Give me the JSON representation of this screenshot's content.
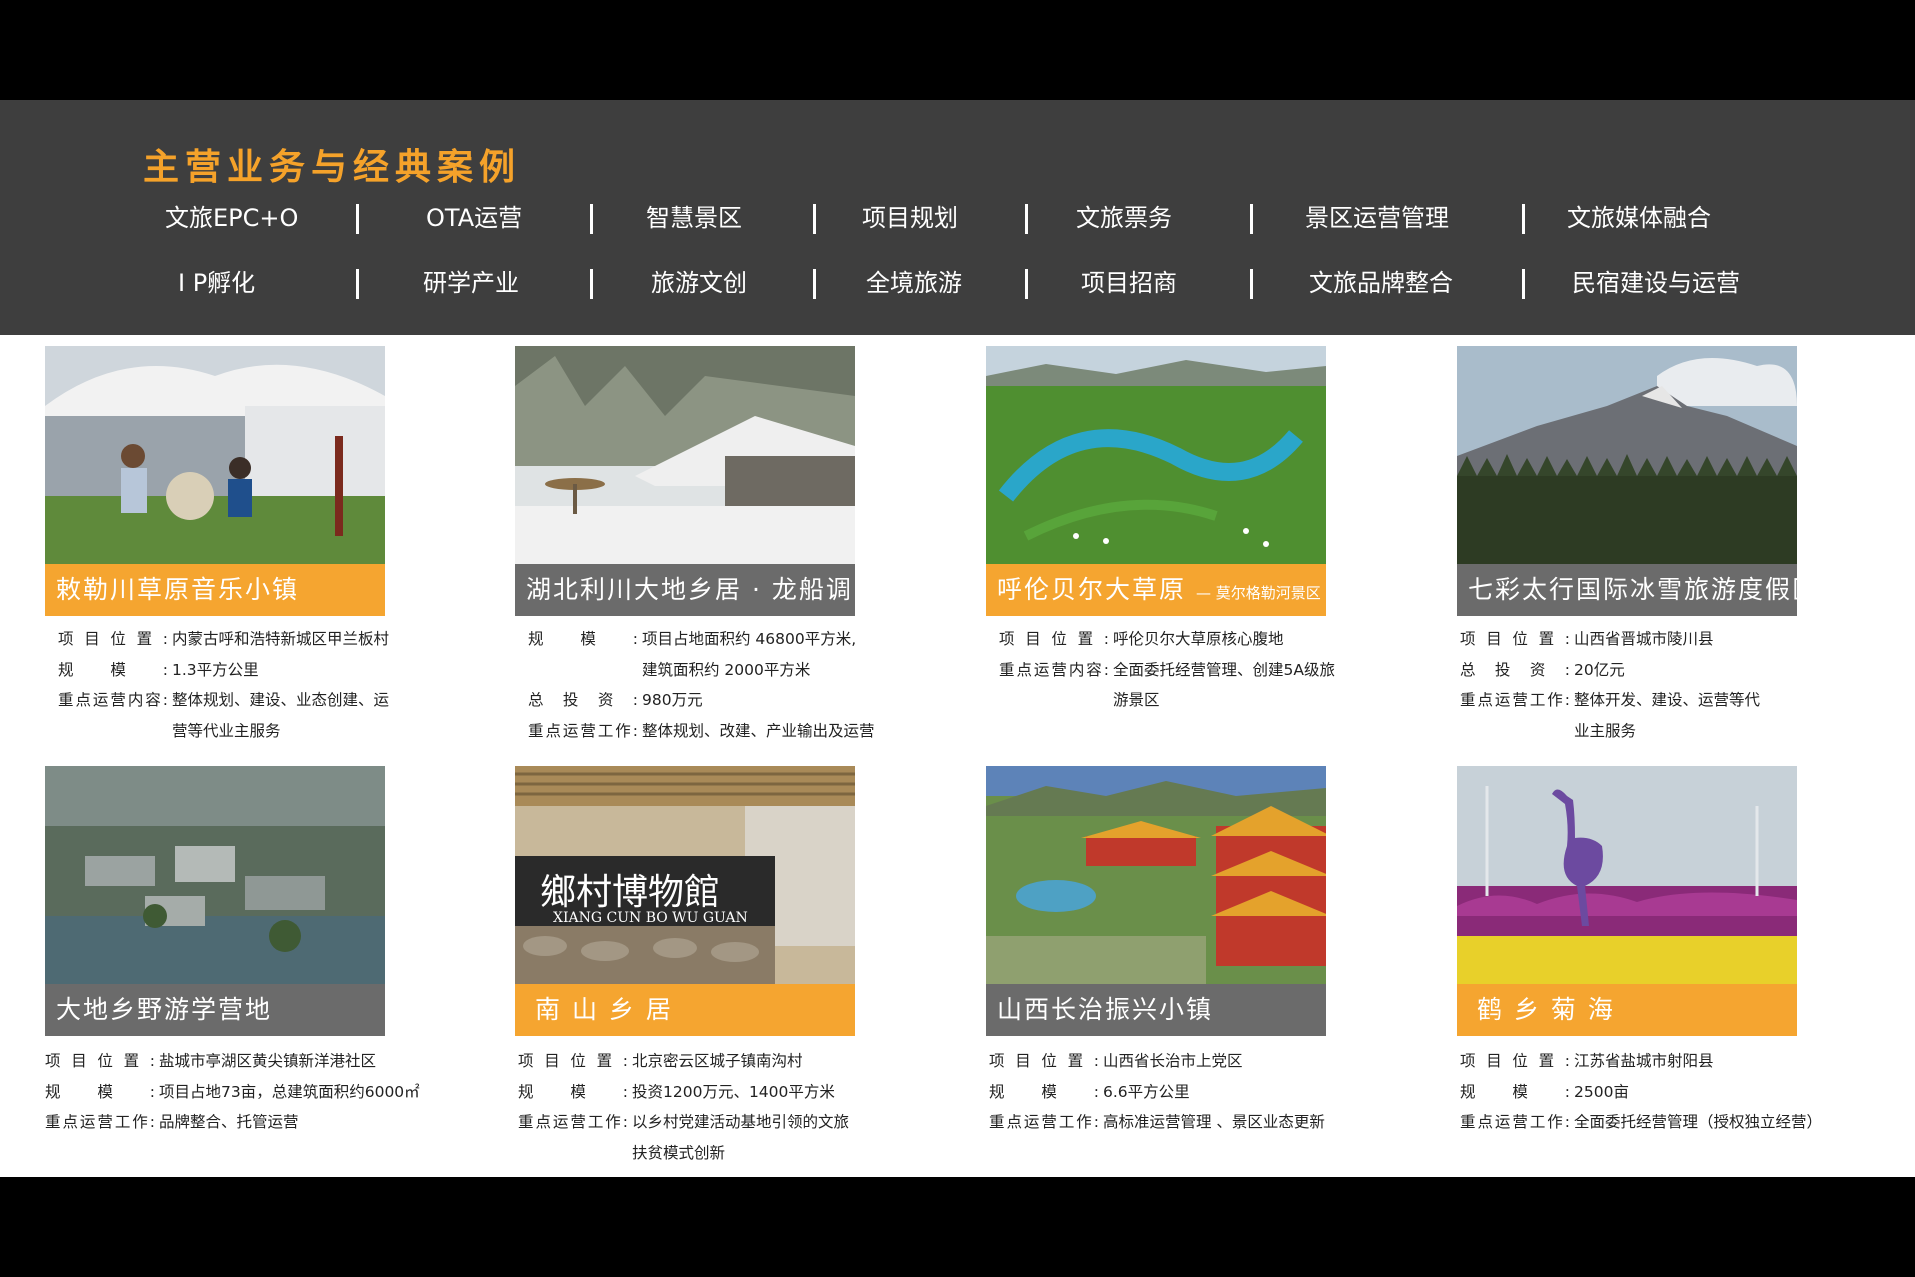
{
  "header": {
    "title": "主营业务与经典案例",
    "services_row1": [
      "文旅EPC+O",
      "OTA运营",
      "智慧景区",
      "项目规划",
      "文旅票务",
      "景区运营管理",
      "文旅媒体融合"
    ],
    "services_row2": [
      "I P孵化",
      "研学产业",
      "旅游文创",
      "全境旅游",
      "项目招商",
      "文旅品牌整合",
      "民宿建设与运营"
    ]
  },
  "colors": {
    "accent": "#f5a22a",
    "header_bg": "#3e3e3e",
    "banner_orange": "#f5a530",
    "banner_gray": "#6b6b6b"
  },
  "cases": [
    {
      "name": "敕勒川草原音乐小镇",
      "sub": "",
      "rows": [
        {
          "label": "项目位置:",
          "value": "内蒙古呼和浩特新城区甲兰板村"
        },
        {
          "label": "规模:",
          "value": "1.3平方公里"
        },
        {
          "label": "重点运营内容:",
          "value": "整体规划、建设、业态创建、运"
        },
        {
          "label": "",
          "value": "营等代业主服务"
        }
      ]
    },
    {
      "name": "湖北利川大地乡居 · 龙船调",
      "sub": "",
      "rows": [
        {
          "label": "规模:",
          "value": "项目占地面积约 46800平方米,"
        },
        {
          "label": "",
          "value": "建筑面积约 2000平方米"
        },
        {
          "label": "总投资:",
          "value": "980万元"
        },
        {
          "label": "重点运营工作:",
          "value": "整体规划、改建、产业输出及运营"
        }
      ]
    },
    {
      "name": "呼伦贝尔大草原",
      "sub": "— 莫尔格勒河景区",
      "rows": [
        {
          "label": "项目位置:",
          "value": "呼伦贝尔大草原核心腹地"
        },
        {
          "label": "重点运营内容:",
          "value": "全面委托经营管理、创建5A级旅"
        },
        {
          "label": "",
          "value": "游景区"
        }
      ]
    },
    {
      "name": "七彩太行国际冰雪旅游度假区",
      "sub": "",
      "rows": [
        {
          "label": "项目位置:",
          "value": "山西省晋城市陵川县"
        },
        {
          "label": "总投资:",
          "value": "20亿元"
        },
        {
          "label": "重点运营工作:",
          "value": "整体开发、建设、运营等代"
        },
        {
          "label": "",
          "value": "业主服务"
        }
      ]
    },
    {
      "name": "大地乡野游学营地",
      "sub": "",
      "rows": [
        {
          "label": "项目位置:",
          "value": "盐城市亭湖区黄尖镇新洋港社区"
        },
        {
          "label": "规模:",
          "value": "项目占地73亩，总建筑面积约6000㎡"
        },
        {
          "label": "重点运营工作:",
          "value": "品牌整合、托管运营"
        }
      ]
    },
    {
      "name": "南 山 乡 居",
      "sub": "",
      "rows": [
        {
          "label": "项目位置:",
          "value": "北京密云区城子镇南沟村"
        },
        {
          "label": "规模:",
          "value": "投资1200万元、1400平方米"
        },
        {
          "label": "重点运营工作:",
          "value": "以乡村党建活动基地引领的文旅"
        },
        {
          "label": "",
          "value": "扶贫模式创新"
        }
      ]
    },
    {
      "name": "山西长治振兴小镇",
      "sub": "",
      "rows": [
        {
          "label": "项目位置:",
          "value": "山西省长治市上党区"
        },
        {
          "label": "规模:",
          "value": "6.6平方公里"
        },
        {
          "label": "重点运营工作:",
          "value": "高标准运营管理 、景区业态更新"
        }
      ]
    },
    {
      "name": "鹤 乡 菊 海",
      "sub": "",
      "rows": [
        {
          "label": "项目位置:",
          "value": "江苏省盐城市射阳县"
        },
        {
          "label": "规模:",
          "value": "2500亩"
        },
        {
          "label": "重点运营工作:",
          "value": "全面委托经营管理（授权独立经营）"
        }
      ]
    }
  ]
}
